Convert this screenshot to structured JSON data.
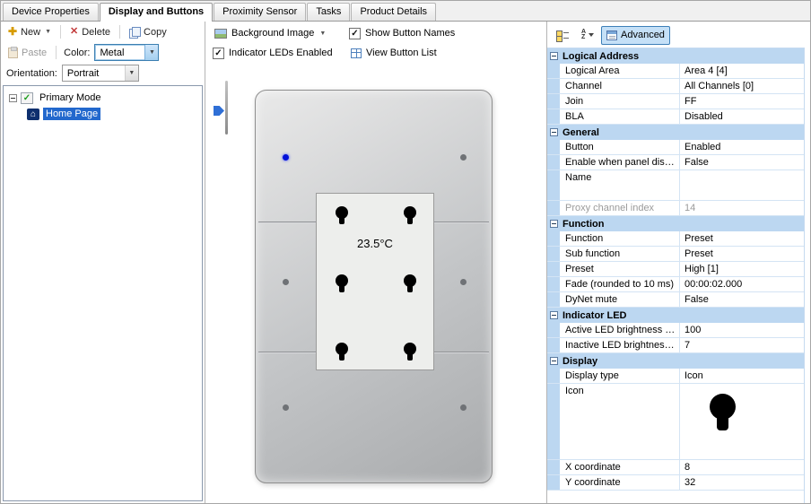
{
  "tabs": [
    {
      "label": "Device Properties"
    },
    {
      "label": "Display and Buttons"
    },
    {
      "label": "Proximity Sensor"
    },
    {
      "label": "Tasks"
    },
    {
      "label": "Product Details"
    }
  ],
  "left_toolbar": {
    "new_label": "New",
    "delete_label": "Delete",
    "copy_label": "Copy",
    "paste_label": "Paste",
    "color_label": "Color:",
    "color_value": "Metal",
    "orientation_label": "Orientation:",
    "orientation_value": "Portrait"
  },
  "tree": {
    "root_label": "Primary Mode",
    "child_label": "Home Page"
  },
  "preview_toolbar": {
    "background_image_label": "Background Image",
    "show_button_names_label": "Show Button Names",
    "indicator_leds_label": "Indicator LEDs Enabled",
    "view_button_list_label": "View Button List"
  },
  "preview": {
    "temperature": "23.5°C",
    "active_led_color": "#0010d8"
  },
  "property_panel": {
    "advanced_label": "Advanced",
    "rows": [
      {
        "type": "category",
        "label": "Logical Address"
      },
      {
        "type": "item",
        "label": "Logical Area",
        "value": "Area 4 [4]"
      },
      {
        "type": "item",
        "label": "Channel",
        "value": "All Channels [0]"
      },
      {
        "type": "item",
        "label": "Join",
        "value": "FF"
      },
      {
        "type": "item",
        "label": "BLA",
        "value": "Disabled"
      },
      {
        "type": "category",
        "label": "General"
      },
      {
        "type": "item",
        "label": "Button",
        "value": "Enabled"
      },
      {
        "type": "item",
        "label": "Enable when panel disa...",
        "value": "False"
      },
      {
        "type": "item",
        "label": "Name",
        "value": ""
      },
      {
        "type": "item",
        "label": "Proxy channel index",
        "value": "14"
      },
      {
        "type": "category",
        "label": "Function"
      },
      {
        "type": "item",
        "label": "Function",
        "value": "Preset"
      },
      {
        "type": "item",
        "label": "Sub function",
        "value": "Preset"
      },
      {
        "type": "item",
        "label": "Preset",
        "value": "High [1]"
      },
      {
        "type": "item",
        "label": "Fade (rounded to 10 ms)",
        "value": "00:00:02.000"
      },
      {
        "type": "item",
        "label": "DyNet mute",
        "value": "False"
      },
      {
        "type": "category",
        "label": "Indicator LED"
      },
      {
        "type": "item",
        "label": "Active LED brightness (%)",
        "value": "100"
      },
      {
        "type": "item",
        "label": "Inactive LED brightness ...",
        "value": "7"
      },
      {
        "type": "category",
        "label": "Display"
      },
      {
        "type": "item",
        "label": "Display type",
        "value": "Icon"
      },
      {
        "type": "item",
        "label": "Icon",
        "value": ""
      },
      {
        "type": "item",
        "label": "X coordinate",
        "value": "8"
      },
      {
        "type": "item",
        "label": "Y coordinate",
        "value": "32"
      }
    ]
  }
}
